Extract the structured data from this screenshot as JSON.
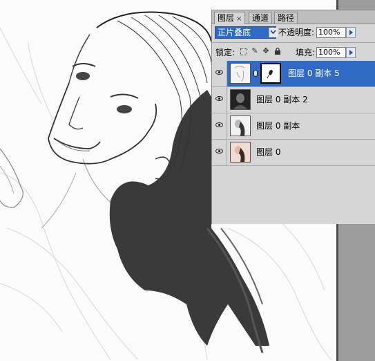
{
  "panel": {
    "tabs": [
      {
        "label": "图层",
        "close": "×"
      },
      {
        "label": "通道"
      },
      {
        "label": "路径"
      }
    ],
    "blend_mode": "正片叠底",
    "opacity_label": "不透明度:",
    "opacity_value": "100%",
    "lock_label": "锁定:",
    "fill_label": "填充:",
    "fill_value": "100%",
    "layers": [
      {
        "name": "图层 0 副本 5",
        "selected": true
      },
      {
        "name": "图层 0 副本 2",
        "selected": false
      },
      {
        "name": "图层 0 副本",
        "selected": false
      },
      {
        "name": "图层 0",
        "selected": false
      }
    ]
  },
  "colors": {
    "selection": "#316ac5",
    "panel_bg": "#d6d6d6",
    "workspace_gray": "#9c9c9c"
  },
  "icons": [
    "eye-icon",
    "chain-link-icon",
    "lock-transparency-icon",
    "lock-brush-icon",
    "lock-move-icon",
    "lock-all-icon",
    "dropdown-arrow-icon",
    "flyout-arrow-icon"
  ]
}
